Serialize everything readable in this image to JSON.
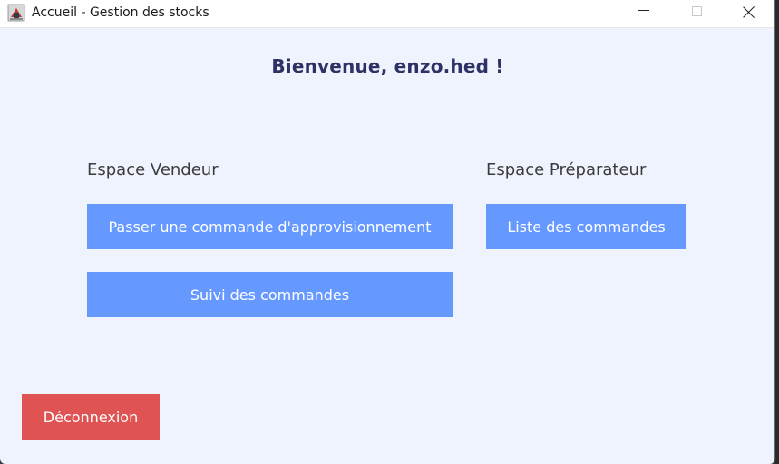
{
  "window": {
    "title": "Accueil - Gestion des stocks",
    "app_icon": "java-cup-icon"
  },
  "welcome": "Bienvenue, enzo.hed !",
  "vendeur": {
    "title": "Espace Vendeur",
    "buttons": [
      "Passer une commande d'approvisionnement",
      "Suivi des commandes"
    ]
  },
  "preparateur": {
    "title": "Espace Préparateur",
    "buttons": [
      "Liste des commandes"
    ]
  },
  "logout_label": "Déconnexion",
  "colors": {
    "background": "#eff3fd",
    "primary_button": "#6699ff",
    "logout_button": "#df5353",
    "welcome_text": "#2d3163"
  }
}
